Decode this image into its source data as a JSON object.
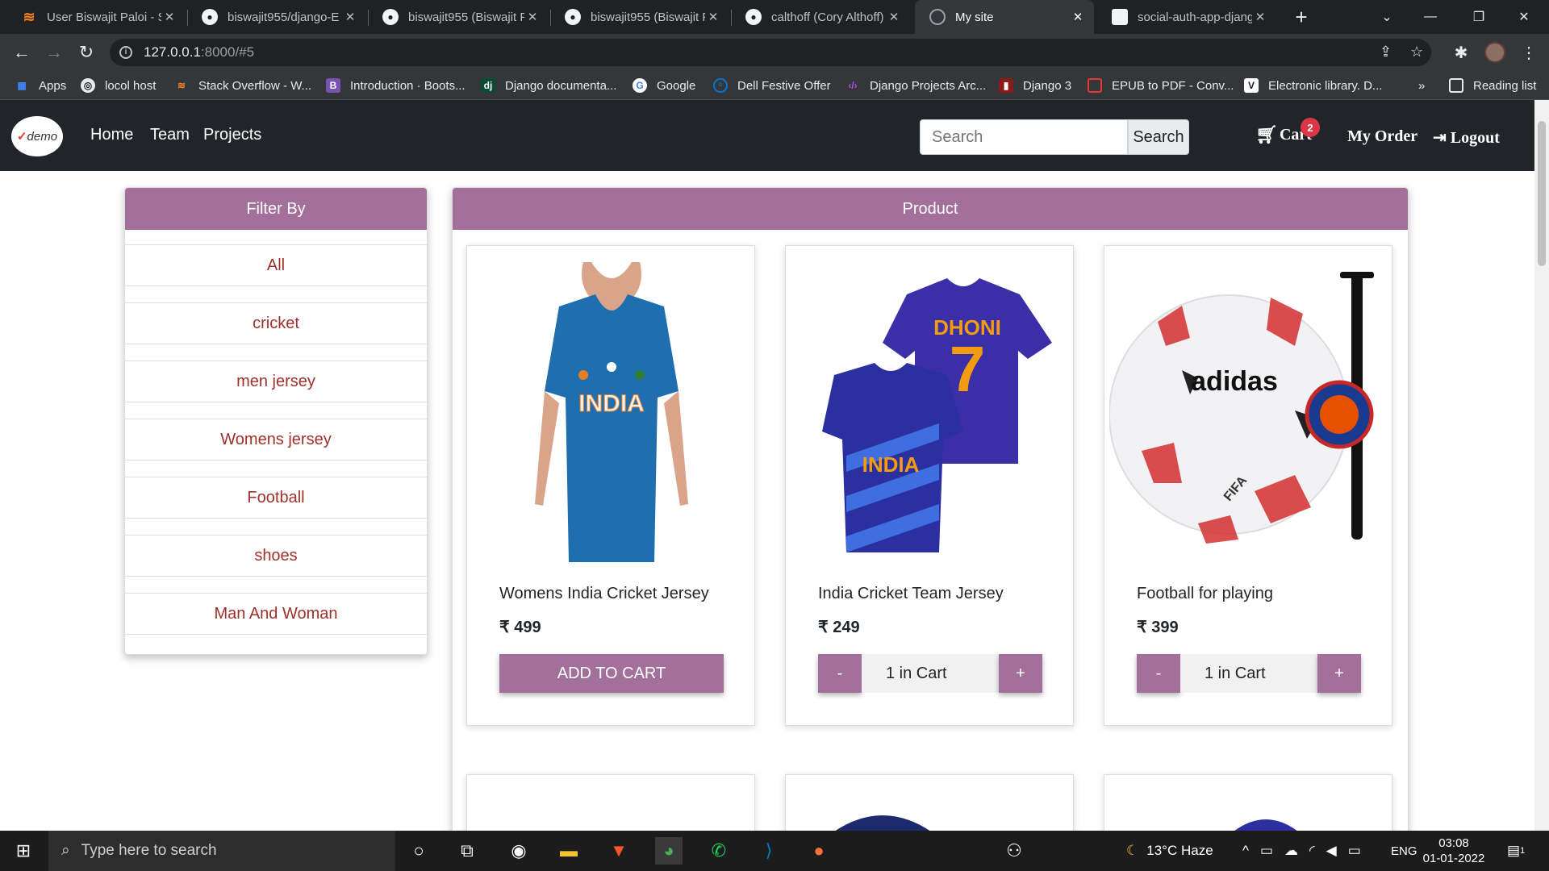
{
  "browser": {
    "tabs": [
      {
        "title": "User Biswajit Paloi - St",
        "icon": "stackoverflow-icon"
      },
      {
        "title": "biswajit955/django-E",
        "icon": "github-icon"
      },
      {
        "title": "biswajit955 (Biswajit P",
        "icon": "github-icon"
      },
      {
        "title": "biswajit955 (Biswajit P",
        "icon": "github-icon"
      },
      {
        "title": "calthoff (Cory Althoff)",
        "icon": "github-icon"
      },
      {
        "title": "My site",
        "icon": "globe-icon"
      },
      {
        "title": "social-auth-app-djang",
        "icon": "page-icon"
      }
    ],
    "url_host": "127.0.0.1",
    "url_rest": ":8000/#5",
    "bookmarks": [
      {
        "label": "Apps"
      },
      {
        "label": "locol host"
      },
      {
        "label": "Stack Overflow - W..."
      },
      {
        "label": "Introduction · Boots..."
      },
      {
        "label": "Django documenta..."
      },
      {
        "label": "Google"
      },
      {
        "label": "Dell Festive Offer"
      },
      {
        "label": "Django Projects Arc..."
      },
      {
        "label": "Django 3"
      },
      {
        "label": "EPUB to PDF - Conv..."
      },
      {
        "label": "Electronic library. D..."
      }
    ],
    "bookmarks_more": "»",
    "reading_list": "Reading list"
  },
  "site": {
    "logo_text": "demo",
    "nav": [
      "Home",
      "Team",
      "Projects"
    ],
    "search_placeholder": "Search",
    "search_button": "Search",
    "cart_label": "Cart",
    "cart_count": "2",
    "my_order": "My Order",
    "logout": "Logout"
  },
  "filter": {
    "heading": "Filter By",
    "items": [
      "All",
      "cricket",
      "men jersey",
      "Womens jersey",
      "Football",
      "shoes",
      "Man And Woman"
    ]
  },
  "products": {
    "heading": "Product",
    "items": [
      {
        "name": "Womens India Cricket Jersey",
        "price": "₹ 499",
        "action": "ADD TO CART"
      },
      {
        "name": "India Cricket Team Jersey",
        "price": "₹ 249",
        "minus": "-",
        "qty": "1 in Cart",
        "plus": "+"
      },
      {
        "name": "Football for playing",
        "price": "₹ 399",
        "minus": "-",
        "qty": "1 in Cart",
        "plus": "+"
      }
    ],
    "image_texts": {
      "india": "INDIA",
      "dhoni": "DHONI",
      "number": "7",
      "brand": "adidas",
      "fifa": "FIFA"
    }
  },
  "taskbar": {
    "search_placeholder": "Type here to search",
    "weather": "13°C  Haze",
    "lang": "ENG",
    "time": "03:08",
    "date": "01-01-2022",
    "notif_count": "1"
  }
}
